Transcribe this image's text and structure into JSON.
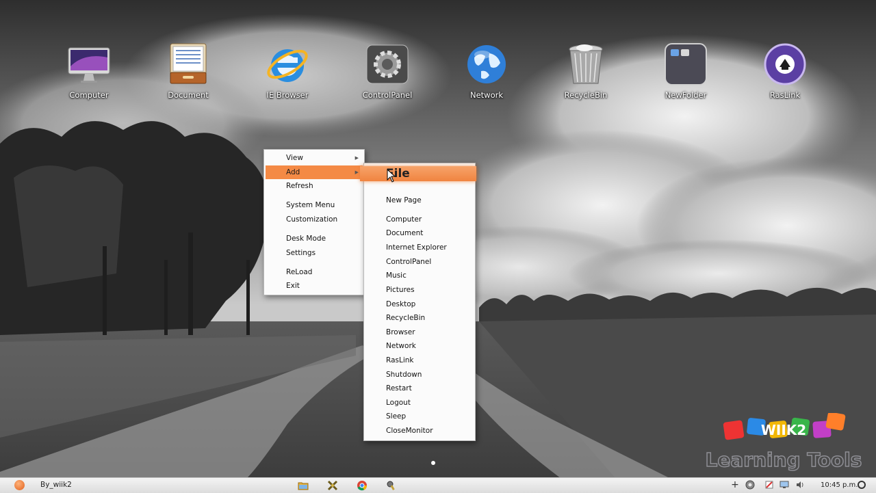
{
  "desktop_icons": [
    {
      "label": "Computer",
      "icon": "imac-icon"
    },
    {
      "label": "Document",
      "icon": "drawer-icon"
    },
    {
      "label": "IE Browser",
      "icon": "internet-explorer-icon"
    },
    {
      "label": "ControlPanel",
      "icon": "gear-panel-icon"
    },
    {
      "label": "Network",
      "icon": "globe-icon"
    },
    {
      "label": "RecycleBin",
      "icon": "trash-bin-icon"
    },
    {
      "label": "NewFolder",
      "icon": "folder-tile-icon"
    },
    {
      "label": "RasLink",
      "icon": "raslink-icon"
    }
  ],
  "context_menu": {
    "items": [
      "View",
      "Add",
      "Refresh",
      "System Menu",
      "Customization",
      "Desk Mode",
      "Settings",
      "ReLoad",
      "Exit"
    ],
    "active": "Add",
    "accent_color": "#f48a45"
  },
  "submenu": {
    "items": [
      "File",
      "New Page",
      "Computer",
      "Document",
      "Internet Explorer",
      "ControlPanel",
      "Music",
      "Pictures",
      "Desktop",
      "RecycleBin",
      "Browser",
      "Network",
      "RasLink",
      "Shutdown",
      "Restart",
      "Logout",
      "Sleep",
      "CloseMonitor"
    ],
    "active": "File"
  },
  "taskbar": {
    "start_icon": "orange-orb-icon",
    "window_title": "By_wiik2",
    "apps": [
      "folder-icon",
      "tools-icon",
      "chrome-icon",
      "gear-wrench-icon"
    ],
    "tray": [
      "plus-icon",
      "network-icon",
      "security-icon",
      "monitor-icon",
      "volume-icon"
    ],
    "clock": "10:45 p.m."
  },
  "watermark": {
    "text": "WIIK2",
    "subtitle": "Learning Tools"
  }
}
